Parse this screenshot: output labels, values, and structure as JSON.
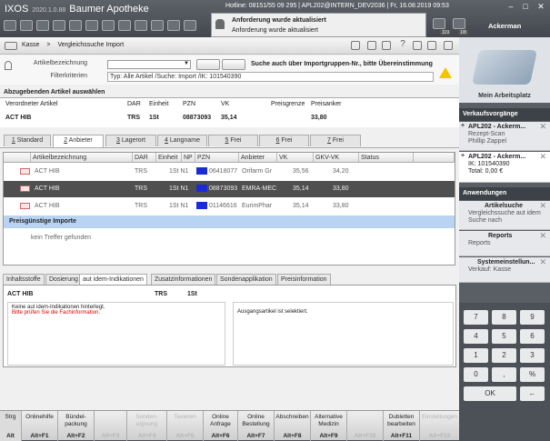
{
  "titlebar": {
    "app": "IXOS",
    "version": "2020.1.0.88",
    "pharmacy": "Baumer Apotheke",
    "hotline": "Hotline: 08151/55 09 295",
    "station": "APL202@INTERN_DEV2036",
    "date": "Fr, 16.08.2019",
    "time": "09:53",
    "notif_line1": "Anforderung wurde aktualisiert",
    "notif_line2": "Anforderung wurde aktualisiert",
    "badge_mail": "119",
    "badge_user": "1/8",
    "user": "Ackerman",
    "win_min": "–",
    "win_max": "□",
    "win_close": "✕"
  },
  "toolbar": {
    "back": "Kasse",
    "sep": ">",
    "current": "Vergleichssuche Import",
    "help": "?"
  },
  "search": {
    "label_article": "Artikelbezeichnung",
    "label_filter": "Filterkriterien",
    "hint": "Suche auch über Importgruppen-Nr., bitte Übereinstimmung",
    "filter_value": "Typ: Alle Artikel /Suche: Import /IK: 101540390"
  },
  "section": {
    "title": "Abzugebenden Artikel auswählen",
    "headers": [
      "Verordneter Artikel",
      "DAR",
      "Einheit",
      "PZN",
      "VK",
      "Preisgrenze",
      "Preisanker"
    ],
    "values": [
      "ACT HIB",
      "TRS",
      "1St",
      "08873093",
      "35,14",
      "",
      "33,80"
    ]
  },
  "tabs": [
    {
      "key": "1",
      "label": " Standard"
    },
    {
      "key": "2",
      "label": " Anbieter"
    },
    {
      "key": "3",
      "label": " Lagerort"
    },
    {
      "key": "4",
      "label": " Langname"
    },
    {
      "key": "5",
      "label": " Frei"
    },
    {
      "key": "6",
      "label": " Frei"
    },
    {
      "key": "7",
      "label": " Frei"
    }
  ],
  "grid": {
    "headers": [
      "Artikelbezeichnung",
      "DAR",
      "Einheit",
      "NP",
      "PZN",
      "Anbieter",
      "VK",
      "GKV-VK",
      "Status"
    ],
    "rows": [
      {
        "name": "ACT HIB",
        "dar": "TRS",
        "einheit": "1St N1",
        "pzn": "06418077",
        "anbieter": "Orifarm Gr",
        "vk": "35,56",
        "gkv": "34,20"
      },
      {
        "name": "ACT HIB",
        "dar": "TRS",
        "einheit": "1St N1",
        "pzn": "08873093",
        "anbieter": "EMRA-MEC",
        "vk": "35,14",
        "gkv": "33,80"
      },
      {
        "name": "ACT HIB",
        "dar": "TRS",
        "einheit": "1St N1",
        "pzn": "01146616",
        "anbieter": "EurimPhar",
        "vk": "35,14",
        "gkv": "33,80"
      }
    ],
    "group_label": "Preisgünstige Importe",
    "empty": "kein Treffer gefunden"
  },
  "bottom_tabs": [
    "Inhaltsstoffe",
    "Dosierung",
    "aut idem-Indikationen",
    "Zusatzinformationen",
    "Sondenapplikation",
    "Preisinformation"
  ],
  "detail": {
    "name": "ACT HIB",
    "dar": "TRS",
    "unit": "1St",
    "line1": "Keine aut idem-Indikationen hinterlegt.",
    "line2": "Bitte prüfen Sie die Fachinformation.",
    "right": "Ausgangsartikel ist selektiert."
  },
  "right_panel": {
    "arbeitsplatz": "Mein Arbeitsplatz",
    "verkauf_title": "Verkaufsvorgänge",
    "v1_title": "APL202 - Ackerm...",
    "v1_l1": "Rezept-Scan",
    "v1_l2": "Phillip Zappel",
    "v2_title": "APL202 - Ackerm...",
    "v2_l1": "IK: 101540390",
    "v2_l2": "Total: 0,00 €",
    "anw_title": "Anwendungen",
    "a1_title": "Artikelsuche",
    "a1_l1": "Vergleichssuche aut idem",
    "a1_l2": "Suche nach",
    "a2_title": "Reports",
    "a2_l1": "Reports",
    "a3_title": "Systemeinstellun...",
    "a3_l1": "Verkauf: Kasse",
    "plus": "+",
    "x": "✕"
  },
  "keypad": [
    "7",
    "8",
    "9",
    "4",
    "5",
    "6",
    "1",
    "2",
    "3",
    "0",
    ",",
    "%",
    "OK",
    "←"
  ],
  "fkeys": [
    {
      "name": "Strg",
      "key": "Alt"
    },
    {
      "name": "Onlinehilfe",
      "key": "Alt+F1"
    },
    {
      "name": "Bündel-\npackung",
      "key": "Alt+F2"
    },
    {
      "name": "",
      "key": "Alt+F3"
    },
    {
      "name": "Sonden-\neignung",
      "key": "Alt+F4"
    },
    {
      "name": "Taxieren",
      "key": "Alt+F5"
    },
    {
      "name": "Online\nAnfrage",
      "key": "Alt+F6"
    },
    {
      "name": "Online\nBestellung",
      "key": "Alt+F7"
    },
    {
      "name": "Abschreiben",
      "key": "Alt+F8"
    },
    {
      "name": "Alternative\nMedizin",
      "key": "Alt+F9"
    },
    {
      "name": "",
      "key": "Alt+F10"
    },
    {
      "name": "Dubletten\nbearbeiten",
      "key": "Alt+F11"
    },
    {
      "name": "Einstellungen",
      "key": "Alt+F12"
    }
  ]
}
